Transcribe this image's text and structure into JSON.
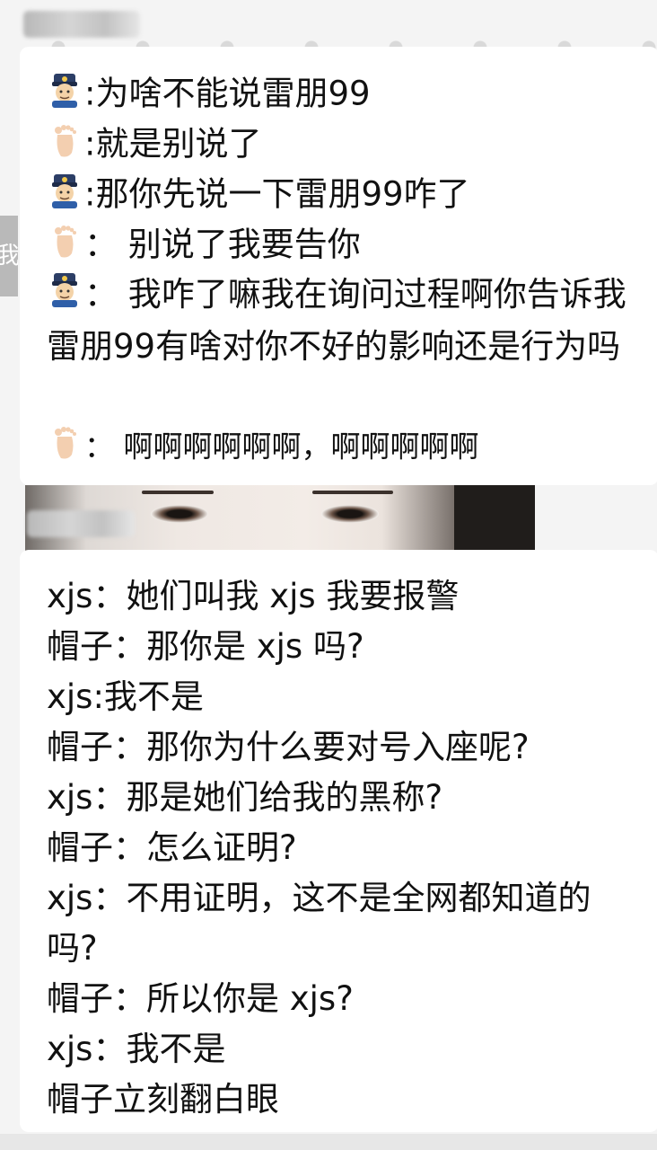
{
  "icons": {
    "police": "police-officer-icon",
    "foot": "foot-icon"
  },
  "top_chat": {
    "lines": [
      {
        "speaker": "police",
        "text": ":为啥不能说雷朋99"
      },
      {
        "speaker": "foot",
        "text": ":就是别说了"
      },
      {
        "speaker": "police",
        "text": ":那你先说一下雷朋99咋了"
      },
      {
        "speaker": "foot",
        "text": "： 别说了我要告你"
      },
      {
        "speaker": "police",
        "text": "： 我咋了嘛我在询问过程啊你告诉我雷朋99有啥对你不好的影响还是行为吗"
      },
      {
        "speaker": "foot",
        "text": "： 啊啊啊啊啊啊，啊啊啊啊啊"
      }
    ]
  },
  "bottom_chat": {
    "lines": [
      "xjs：她们叫我 xjs  我要报警",
      "帽子：那你是 xjs 吗?",
      "xjs:我不是",
      "帽子：那你为什么要对号入座呢?",
      "xjs：那是她们给我的黑称?",
      "帽子：怎么证明?",
      "xjs：不用证明，这不是全网都知道的吗?",
      "帽子：所以你是 xjs?",
      "xjs：我不是",
      "帽子立刻翻白眼"
    ]
  },
  "left_edge_char": "我"
}
